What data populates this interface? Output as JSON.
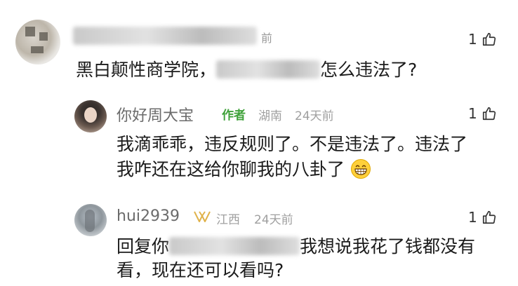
{
  "comments": [
    {
      "meta_time_fragment": "前",
      "text_before": "黑白颠性商学院，",
      "text_after": "怎么违法了?",
      "likes": "1",
      "replies": [
        {
          "name": "你好周大宝",
          "author_badge": "作者",
          "location": "湖南",
          "time": "24天前",
          "likes": "1",
          "text_line1": "我滴乖乖，违反规则了。不是违法了。违法了",
          "text_line2": "我咋还在这给你聊我的八卦了",
          "emoji": "grin-emoji"
        },
        {
          "name": "hui2939",
          "badge_icon": "vip-badge-icon",
          "location": "江西",
          "time": "24天前",
          "likes": "1",
          "text_prefix": "回复你",
          "text_line1_after": "我想说我花了钱都没有",
          "text_line2": "看，现在还可以看吗?"
        }
      ]
    }
  ],
  "colors": {
    "author_badge": "#3fa23a",
    "meta_gray": "#a0a0a0",
    "vip_badge": "#e0b24a"
  }
}
